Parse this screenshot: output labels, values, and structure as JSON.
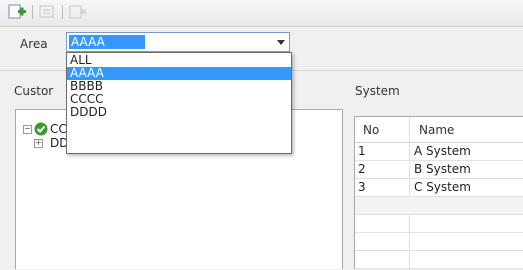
{
  "toolbar": {
    "buttons": [
      {
        "icon": "add-icon",
        "enabled": true
      },
      {
        "icon": "edit-icon",
        "enabled": false
      },
      {
        "icon": "delete-icon",
        "enabled": false
      }
    ]
  },
  "area": {
    "label": "Area",
    "selected": "AAAA",
    "options": [
      "ALL",
      "AAAA",
      "BBBB",
      "CCCC",
      "DDDD"
    ],
    "selected_index": 1
  },
  "customer": {
    "label": "Custor",
    "tree": [
      {
        "label": "CCCC",
        "expander": "minus",
        "checked": true
      },
      {
        "label": "DDDD",
        "expander": "plus",
        "checked": false
      }
    ]
  },
  "system": {
    "label": "System",
    "columns": [
      "No",
      "Name"
    ],
    "rows": [
      [
        "1",
        "A System"
      ],
      [
        "2",
        "B System"
      ],
      [
        "3",
        "C System"
      ]
    ]
  },
  "colors": {
    "accent": "#3399ff",
    "check_green": "#3a9a2a"
  }
}
